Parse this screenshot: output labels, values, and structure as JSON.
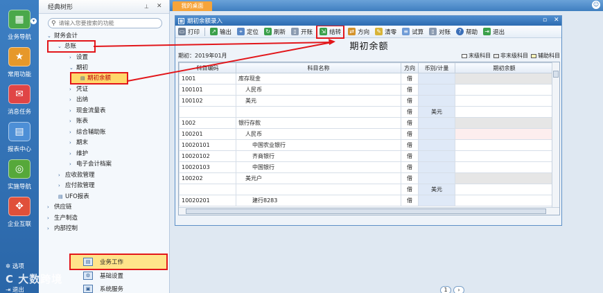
{
  "rail": {
    "items": [
      {
        "label": "业务导航",
        "icon": "grid-icon"
      },
      {
        "label": "常用功能",
        "icon": "star-icon"
      },
      {
        "label": "消息任务",
        "icon": "mail-icon"
      },
      {
        "label": "报表中心",
        "icon": "report-icon"
      },
      {
        "label": "实施导航",
        "icon": "compass-icon"
      },
      {
        "label": "企业互联",
        "icon": "link-icon"
      }
    ],
    "bottom": [
      {
        "label": "选项",
        "icon": "gear-icon"
      },
      {
        "label": "退出",
        "icon": "exit-icon"
      }
    ]
  },
  "tree": {
    "title": "经典树形",
    "search_placeholder": "请输入您要搜索的功能",
    "nodes": [
      {
        "label": "财务会计"
      },
      {
        "label": "总账"
      },
      {
        "label": "设置"
      },
      {
        "label": "期初"
      },
      {
        "label": "期初余额"
      },
      {
        "label": "凭证"
      },
      {
        "label": "出纳"
      },
      {
        "label": "现金流量表"
      },
      {
        "label": "账表"
      },
      {
        "label": "综合辅助账"
      },
      {
        "label": "期末"
      },
      {
        "label": "维护"
      },
      {
        "label": "电子会计档案"
      },
      {
        "label": "应收款管理"
      },
      {
        "label": "应付款管理"
      },
      {
        "label": "UFO报表"
      },
      {
        "label": "供应链"
      },
      {
        "label": "生产制造"
      },
      {
        "label": "内部控制"
      }
    ],
    "bottom_items": [
      {
        "label": "业务工作"
      },
      {
        "label": "基础设置"
      },
      {
        "label": "系统服务"
      }
    ]
  },
  "main": {
    "tab_label": "我的桌面",
    "dialog_title": "期初余额录入",
    "toolbar": [
      {
        "label": "打印",
        "icon": "printer-icon",
        "color": "#6d7f96"
      },
      {
        "label": "输出",
        "icon": "export-icon",
        "color": "#3aa04a"
      },
      {
        "label": "定位",
        "icon": "locate-icon",
        "color": "#5a88c6"
      },
      {
        "label": "刷新",
        "icon": "refresh-icon",
        "color": "#3aa04a"
      },
      {
        "label": "开账",
        "icon": "open-ledger-icon",
        "color": "#8a9ab0"
      },
      {
        "label": "结转",
        "icon": "carry-forward-icon",
        "color": "#3aa04a"
      },
      {
        "label": "方向",
        "icon": "direction-icon",
        "color": "#d4932c"
      },
      {
        "label": "清零",
        "icon": "clear-icon",
        "color": "#d8b438"
      },
      {
        "label": "试算",
        "icon": "calculate-icon",
        "color": "#6f9bd6"
      },
      {
        "label": "对账",
        "icon": "reconcile-icon",
        "color": "#8a9ab0"
      },
      {
        "label": "帮助",
        "icon": "help-icon",
        "color": "#3b6fb8"
      },
      {
        "label": "退出",
        "icon": "exit-icon",
        "color": "#3aa04a"
      }
    ],
    "report_title": "期初余额",
    "period": "期初：2019年01月",
    "legend": [
      {
        "label": "末级科目",
        "color": "#ffffff"
      },
      {
        "label": "非末级科目",
        "color": "#e6e6e6"
      },
      {
        "label": "辅助科目",
        "color": "#fff4b8"
      }
    ],
    "columns": [
      "科目编码",
      "科目名称",
      "方向",
      "币别/计量",
      "期初余额"
    ],
    "rows": [
      {
        "code": "1001",
        "name": "库存现金",
        "indent": 0,
        "dir": "借",
        "cur": "",
        "amt": "",
        "shade": "gray"
      },
      {
        "code": "100101",
        "name": "人民币",
        "indent": 1,
        "dir": "借",
        "cur": "",
        "amt": "",
        "shade": "white"
      },
      {
        "code": "100102",
        "name": "美元",
        "indent": 1,
        "dir": "借",
        "cur": "",
        "amt": "",
        "shade": "white"
      },
      {
        "code": "",
        "name": "",
        "indent": 0,
        "dir": "借",
        "cur": "美元",
        "amt": "",
        "shade": "white"
      },
      {
        "code": "1002",
        "name": "银行存款",
        "indent": 0,
        "dir": "借",
        "cur": "",
        "amt": "",
        "shade": "gray"
      },
      {
        "code": "100201",
        "name": "人民币",
        "indent": 1,
        "dir": "借",
        "cur": "",
        "amt": "",
        "shade": "pink"
      },
      {
        "code": "10020101",
        "name": "中国农业银行",
        "indent": 2,
        "dir": "借",
        "cur": "",
        "amt": "",
        "shade": "white"
      },
      {
        "code": "10020102",
        "name": "齐商银行",
        "indent": 2,
        "dir": "借",
        "cur": "",
        "amt": "",
        "shade": "white"
      },
      {
        "code": "10020103",
        "name": "中国银行",
        "indent": 2,
        "dir": "借",
        "cur": "",
        "amt": "",
        "shade": "white"
      },
      {
        "code": "100202",
        "name": "美元户",
        "indent": 1,
        "dir": "借",
        "cur": "",
        "amt": "",
        "shade": "gray"
      },
      {
        "code": "",
        "name": "",
        "indent": 0,
        "dir": "借",
        "cur": "美元",
        "amt": "",
        "shade": "white"
      },
      {
        "code": "10020201",
        "name": "建行8283",
        "indent": 2,
        "dir": "借",
        "cur": "",
        "amt": "",
        "shade": "white"
      }
    ],
    "pager": [
      "1"
    ]
  },
  "watermark": "C 大数跨境",
  "colors": {
    "highlight": "#e2161a",
    "accent": "#2c6bb0",
    "tab": "#f6a43a"
  }
}
